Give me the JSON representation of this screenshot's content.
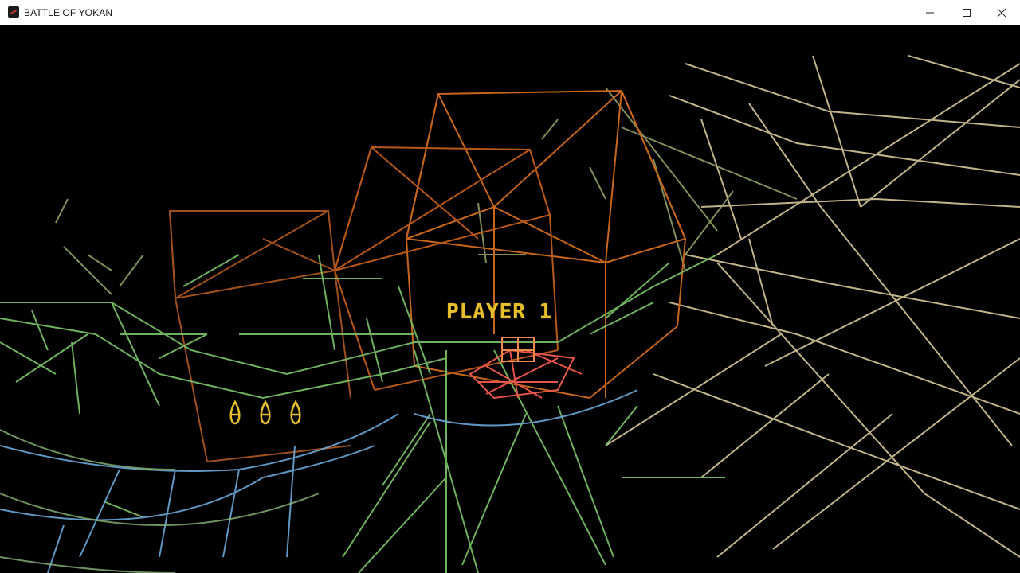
{
  "window": {
    "title": "BATTLE OF YOKAN",
    "icon": "game-app-icon",
    "controls": {
      "minimize": "minimize-icon",
      "maximize": "maximize-icon",
      "close": "close-icon"
    }
  },
  "game": {
    "player_label": "PLAYER 1",
    "lives_icon": "flame-life-icon",
    "lives": 3,
    "colors": {
      "hud_text": "#e6c02c",
      "structure": "#c8661e",
      "terrain_near": "#7ac66a",
      "terrain_far": "#d8c89a",
      "water": "#6aa8d8",
      "player_ship": "#e8554a"
    }
  }
}
